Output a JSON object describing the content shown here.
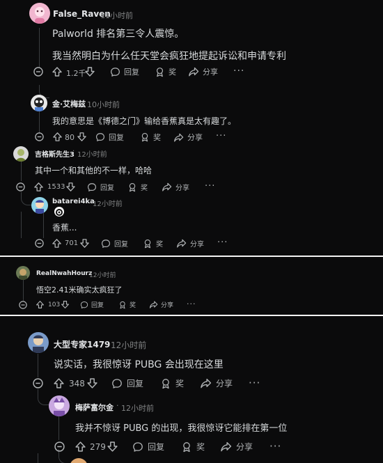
{
  "actions": {
    "reply": "回复",
    "award": "奖",
    "share": "分享"
  },
  "comments": [
    {
      "user": "False_Raven",
      "time": "11小时前",
      "body": [
        "Palworld 排名第三令人震惊。",
        "我当然明白为什么任天堂会疯狂地提起诉讼和申请专利"
      ],
      "votes": "1.2千"
    },
    {
      "user": "金·艾梅兹",
      "time": "10小时前",
      "body": [
        "我的意思是《博德之门》输给香蕉真是太有趣了。"
      ],
      "votes": "80"
    },
    {
      "user": "吉格斯先生3",
      "time": "12小时前",
      "body": [
        "其中一个和其他的不一样，哈哈"
      ],
      "votes": "1533"
    },
    {
      "user": "batarei4ka",
      "time": "12小时前",
      "body": [
        "香蕉..."
      ],
      "votes": "701"
    },
    {
      "user": "RealNwahHourz",
      "time": "12小时前",
      "body": [
        "悟空2.41米确实太疯狂了"
      ],
      "votes": "103"
    },
    {
      "user": "大型专家1479",
      "time": "12小时前",
      "body": [
        "说实话，我很惊讶 PUBG 会出现在这里"
      ],
      "votes": "348"
    },
    {
      "user": "梅萨富尔金",
      "time": "12小时前",
      "body": [
        "我并不惊讶 PUBG 的出现，我很惊讶它能排在第一位"
      ],
      "votes": "279"
    }
  ],
  "colors": {
    "background": "#0b0b0c",
    "text": "#d7dadc",
    "meta": "#818384",
    "thread_line": "#3a3d40"
  }
}
